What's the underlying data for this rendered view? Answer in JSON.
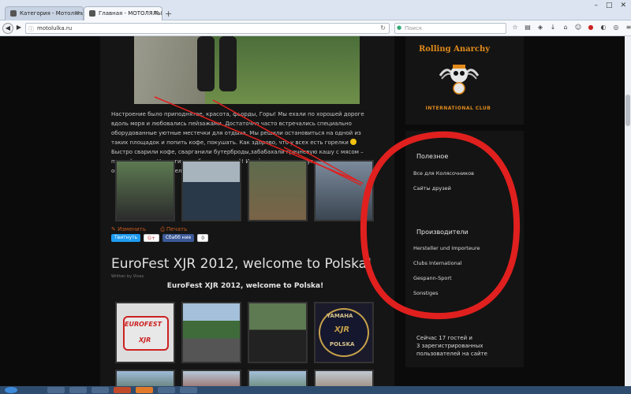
{
  "browser": {
    "tabs": [
      {
        "label": "Категория - Мотолялька..."
      },
      {
        "label": "Главная - МОТОЛЯЛЬКА..."
      }
    ],
    "address": "motolulka.ru",
    "search_placeholder": "Поиск",
    "new_tab_label": "+"
  },
  "article": {
    "text": "Настроение было приподнятое, красота, фьорды, Горы! Мы ехали по хорошей дороге вдоль моря и любовались пейзажами. Достаточно часто встречались специально оборудованные уютные местечки для отдыха. Мы решили остановиться на одной из таких площадок и попить кофе, покушать. Как здорово, что у всех есть горелки ",
    "text_after": " Быстро сварили кофе, сварганили бутерброды,забабахали гречневую кашу с мясом – первый ужин в Норвегии, особенно вкусный! И всё это время вокруг нас кружил огромный морской орел...",
    "actions": {
      "edit": "Изменить",
      "print": "Печать"
    },
    "share": {
      "twitter": "Твитнуть",
      "gplus": "G+",
      "facebook": "Сбабб  ние",
      "count": "0"
    }
  },
  "post": {
    "title": "EuroFest XJR 2012, welcome to Polska!",
    "meta": "Written by Vines",
    "subtitle": "EuroFest XJR 2012, welcome to Polska!",
    "badge_euro": "EUROFEST",
    "badge_xjr": "XJR",
    "badge_yamaha": "YAMAHA",
    "badge_polska": "POLSKA"
  },
  "sidebar": {
    "logo_top": "Rolling Anarchy",
    "logo_bottom": "INTERNATIONAL CLUB",
    "useful": {
      "title": "Полезное",
      "links": [
        "Все для Колясочников",
        "Сайты друзей"
      ]
    },
    "makers": {
      "title": "Производители",
      "links": [
        "Hersteller und Importeure",
        "Clubs International",
        "Gespann-Sport",
        "Sonstiges"
      ]
    },
    "online": {
      "line1": "Сейчас 17 гостей и",
      "line2": "3 зарегистрированных",
      "line3": "пользователей на сайте"
    }
  },
  "colors": {
    "accent": "#e08a1c",
    "annotation": "#e0201e"
  }
}
